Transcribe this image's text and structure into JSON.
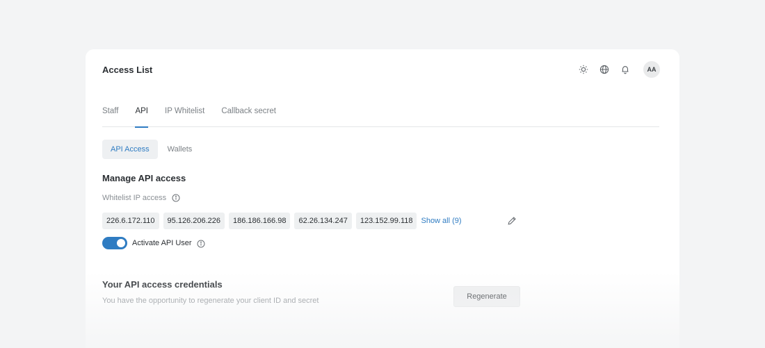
{
  "page": {
    "title": "Access List"
  },
  "header": {
    "icons": [
      "sun-icon",
      "globe-icon",
      "bell-icon"
    ],
    "avatar_initials": "AA"
  },
  "tabs": [
    {
      "label": "Staff",
      "active": false
    },
    {
      "label": "API",
      "active": true
    },
    {
      "label": "IP Whitelist",
      "active": false
    },
    {
      "label": "Callback secret",
      "active": false
    }
  ],
  "subtabs": [
    {
      "label": "API Access",
      "active": true
    },
    {
      "label": "Wallets",
      "active": false
    }
  ],
  "manage": {
    "heading": "Manage API access",
    "whitelist_label": "Whitelist IP access",
    "ips": [
      "226.6.172.110",
      "95.126.206.226",
      "186.186.166.98",
      "62.26.134.247",
      "123.152.99.118"
    ],
    "show_all": "Show all (9)",
    "toggle_label": "Activate API User",
    "toggle_on": true
  },
  "credentials": {
    "heading": "Your API access credentials",
    "description": "You have the opportunity to regenerate your client ID and secret",
    "regenerate_label": "Regenerate"
  },
  "colors": {
    "accent": "#2f7cc2",
    "background": "#f3f4f5",
    "chip": "#eef0f1"
  }
}
